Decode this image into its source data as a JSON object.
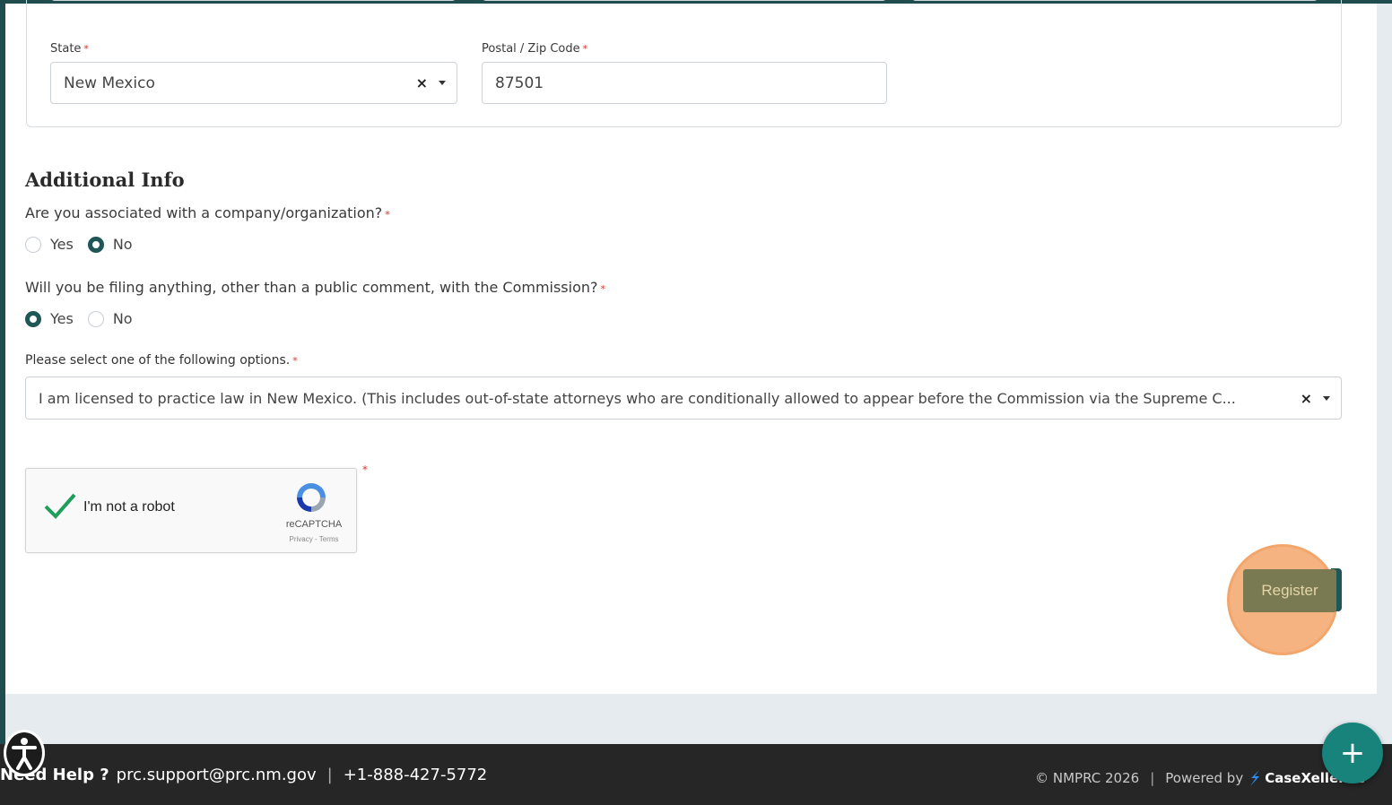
{
  "address": {
    "state_label": "State",
    "state_value": "New Mexico",
    "zip_label": "Postal / Zip Code",
    "zip_value": "87501"
  },
  "additional_info": {
    "title": "Additional Info",
    "q1": {
      "text": "Are you associated with a company/organization?",
      "options": [
        "Yes",
        "No"
      ],
      "selected": "No"
    },
    "q2": {
      "text": "Will you be filing anything, other than a public comment, with the Commission?",
      "options": [
        "Yes",
        "No"
      ],
      "selected": "Yes"
    },
    "options_label": "Please select one of the following options.",
    "options_value": "I am licensed to practice law in New Mexico. (This includes out-of-state attorneys who are conditionally allowed to appear before the Commission via the Supreme C..."
  },
  "required_mark": "*",
  "captcha": {
    "label": "I'm not a robot",
    "brand": "reCAPTCHA",
    "links": "Privacy - Terms"
  },
  "register_label": "Register",
  "footer": {
    "help_prefix": "Need Help ?",
    "email": "prc.support@prc.nm.gov",
    "separator": "|",
    "phone": "+1-888-427-5772",
    "copyright": "© NMPRC 2026",
    "powered_by": "Powered by",
    "brand": "CaseXellence"
  },
  "fab_symbol": "+",
  "colors": {
    "accent": "#1f5656",
    "required": "#d9342b",
    "fab": "#17837a",
    "highlight": "#f2a66b"
  }
}
